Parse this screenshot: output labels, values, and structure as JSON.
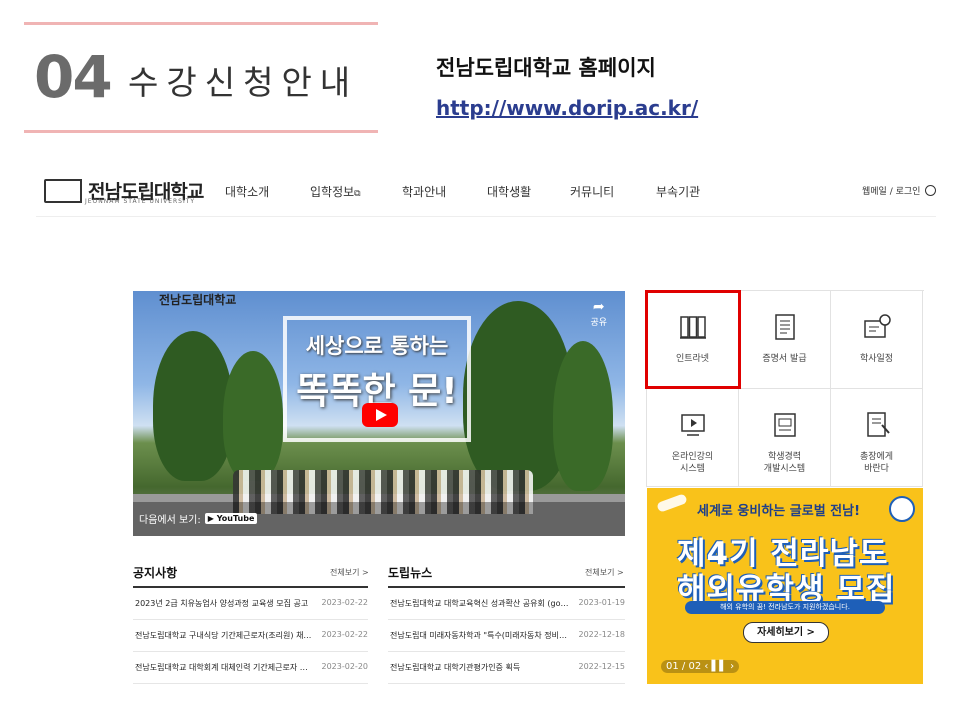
{
  "slide": {
    "section_number": "04",
    "section_title": "수강신청안내",
    "site_title": "전남도립대학교 홈페이지",
    "site_url": "http://www.dorip.ac.kr/"
  },
  "header": {
    "logo_text": "전남도립대학교",
    "logo_sub": "JEONNAM STATE UNIVERSITY",
    "nav": [
      "대학소개",
      "입학정보",
      "학과안내",
      "대학생활",
      "커뮤니티",
      "부속기관"
    ],
    "top_links": "웹메일 / 로그인"
  },
  "video": {
    "logo": "전남도립대학교",
    "share_label": "공유",
    "headline1": "세상으로 통하는",
    "headline2": "똑똑한 문!",
    "watch_on": "다음에서 보기:",
    "youtube": "YouTube"
  },
  "quick_menu": [
    {
      "label": "인트라넷",
      "icon": "intranet-icon"
    },
    {
      "label": "증명서 발급",
      "icon": "certificate-icon"
    },
    {
      "label": "학사일정",
      "icon": "calendar-icon"
    },
    {
      "label": "온라인강의\n시스템",
      "icon": "online-lecture-icon"
    },
    {
      "label": "학생경력\n개발시스템",
      "icon": "career-icon"
    },
    {
      "label": "총장에게\n바란다",
      "icon": "message-icon"
    }
  ],
  "banner": {
    "top_text": "세계로 웅비하는 글로벌 전남!",
    "main1": "제4기 전라남도",
    "main2": "해외유학생 모집",
    "strip": "해외 유학의 꿈! 전라남도가 지원하겠습니다.",
    "button": "자세히보기 >",
    "pager": "01 / 02"
  },
  "notice": {
    "title": "공지사항",
    "more": "전체보기 >",
    "items": [
      {
        "title": "2023년 2급 치유농업사 양성과정 교육생 모집 공고",
        "date": "2023-02-22"
      },
      {
        "title": "전남도립대학교 구내식당 기간제근로자(조리원) 채…",
        "date": "2023-02-22"
      },
      {
        "title": "전남도립대학교 대학회계 대체인력 기간제근로자 …",
        "date": "2023-02-20"
      }
    ]
  },
  "news": {
    "title": "도립뉴스",
    "more": "전체보기 >",
    "items": [
      {
        "title": "전남도립대학교 대학교육혁신 성과확산 공유회 (go …",
        "date": "2023-01-19"
      },
      {
        "title": "전남도립대 미래자동차학과 \"특수(미래자동차 정비)…",
        "date": "2022-12-18"
      },
      {
        "title": "전남도립대학교 대학기관평가인증 획득",
        "date": "2022-12-15"
      }
    ]
  },
  "colors": {
    "highlight": "#e00000",
    "banner_bg": "#f9c21a",
    "banner_blue": "#1e5fb8",
    "rule": "#f0b4b4",
    "url": "#2b3d8f"
  }
}
